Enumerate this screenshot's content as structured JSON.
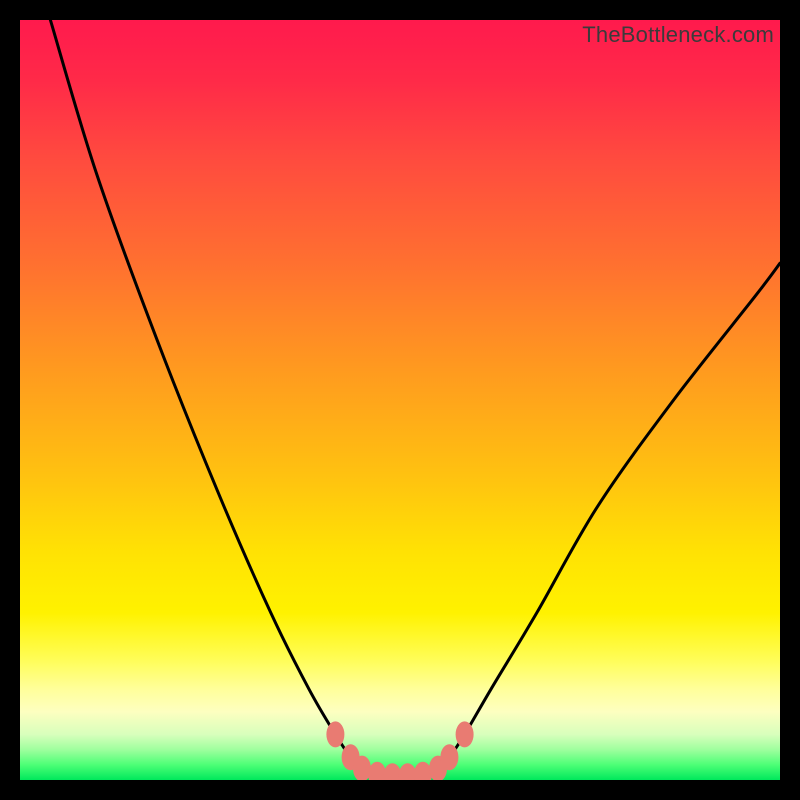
{
  "watermark": "TheBottleneck.com",
  "chart_data": {
    "type": "line",
    "title": "",
    "xlabel": "",
    "ylabel": "",
    "xlim": [
      0,
      100
    ],
    "ylim": [
      0,
      100
    ],
    "grid": false,
    "series": [
      {
        "name": "curve",
        "x": [
          4,
          10,
          18,
          26,
          33,
          38,
          41.5,
          43.5,
          45,
          47,
          50,
          53,
          55,
          56.5,
          58.5,
          62,
          68,
          76,
          86,
          97,
          100
        ],
        "y": [
          100,
          80,
          58,
          38,
          22,
          12,
          6,
          3,
          1.5,
          0.6,
          0.4,
          0.6,
          1.5,
          3,
          6,
          12,
          22,
          36,
          50,
          64,
          68
        ]
      }
    ],
    "markers": [
      {
        "x": 41.5,
        "y": 6
      },
      {
        "x": 43.5,
        "y": 3
      },
      {
        "x": 45.0,
        "y": 1.5
      },
      {
        "x": 47.0,
        "y": 0.7
      },
      {
        "x": 49.0,
        "y": 0.5
      },
      {
        "x": 51.0,
        "y": 0.5
      },
      {
        "x": 53.0,
        "y": 0.7
      },
      {
        "x": 55.0,
        "y": 1.5
      },
      {
        "x": 56.5,
        "y": 3
      },
      {
        "x": 58.5,
        "y": 6
      }
    ],
    "marker_color": "#e97b72",
    "curve_color": "#000000"
  }
}
